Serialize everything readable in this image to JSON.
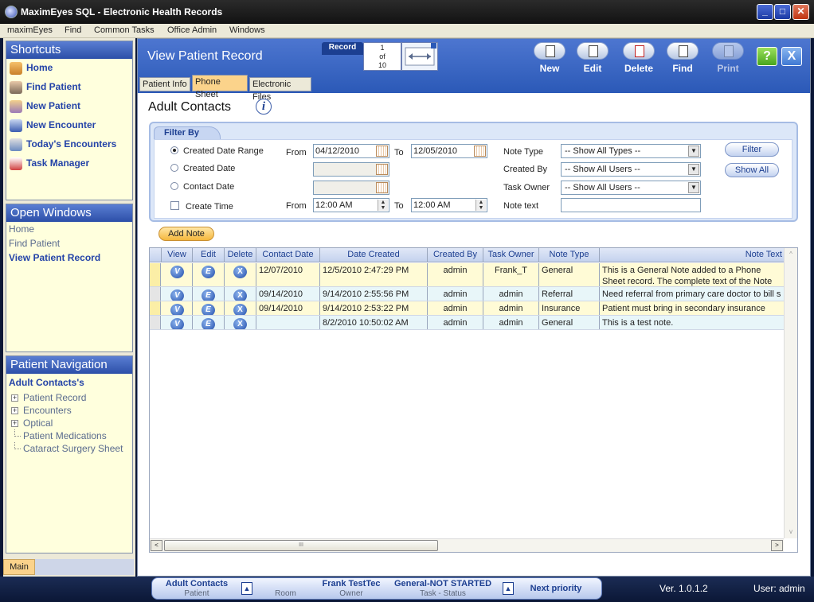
{
  "window": {
    "title": "MaximEyes SQL - Electronic Health Records",
    "controls": {
      "minimize": "_",
      "maximize": "□",
      "close": "✕"
    }
  },
  "menu": [
    "maximEyes",
    "Find",
    "Common Tasks",
    "Office Admin",
    "Windows"
  ],
  "shortcuts": {
    "title": "Shortcuts",
    "items": [
      {
        "label": "Home",
        "icon": "home-icon"
      },
      {
        "label": "Find Patient",
        "icon": "find-patient-icon"
      },
      {
        "label": "New Patient",
        "icon": "new-patient-icon"
      },
      {
        "label": "New Encounter",
        "icon": "new-encounter-icon"
      },
      {
        "label": "Today's Encounters",
        "icon": "todays-encounters-icon"
      },
      {
        "label": "Task Manager",
        "icon": "task-manager-icon"
      }
    ]
  },
  "open_windows": {
    "title": "Open Windows",
    "items": [
      "Home",
      "Find Patient",
      "View Patient Record"
    ],
    "active": "View Patient Record"
  },
  "patient_nav": {
    "title": "Patient Navigation",
    "patient": "Adult Contacts's",
    "items": [
      {
        "label": "Patient Record",
        "expandable": true
      },
      {
        "label": "Encounters",
        "expandable": true
      },
      {
        "label": "Optical",
        "expandable": true
      },
      {
        "label": "Patient Medications",
        "expandable": false
      },
      {
        "label": "Cataract Surgery Sheet",
        "expandable": false
      }
    ],
    "expand_glyph": "+"
  },
  "left_tab": "Main",
  "header": {
    "title": "View Patient Record",
    "record_label": "Record",
    "record_index": "1",
    "record_of": "of",
    "record_total": "10",
    "toolbar": [
      {
        "label": "New",
        "icon": "new-document-icon",
        "enabled": true
      },
      {
        "label": "Edit",
        "icon": "edit-document-icon",
        "enabled": true
      },
      {
        "label": "Delete",
        "icon": "delete-document-icon",
        "enabled": true
      },
      {
        "label": "Find",
        "icon": "find-document-icon",
        "enabled": true
      },
      {
        "label": "Print",
        "icon": "print-icon",
        "enabled": false
      }
    ],
    "help": "?",
    "close": "X"
  },
  "tabs": [
    "Patient Info",
    "Phone Sheet",
    "Electronic Files"
  ],
  "active_tab": "Phone Sheet",
  "section_title": "Adult Contacts",
  "info_glyph": "i",
  "filter": {
    "title": "Filter By",
    "radios": [
      {
        "label": "Created Date Range",
        "checked": true
      },
      {
        "label": "Created Date",
        "checked": false
      },
      {
        "label": "Contact Date",
        "checked": false
      }
    ],
    "create_time_label": "Create Time",
    "from_label": "From",
    "to_label": "To",
    "date_from": "04/12/2010",
    "date_to": "12/05/2010",
    "time_from": "12:00 AM",
    "time_to": "12:00 AM",
    "note_type_label": "Note Type",
    "note_type_value": "-- Show All Types --",
    "created_by_label": "Created By",
    "created_by_value": "-- Show All Users --",
    "task_owner_label": "Task Owner",
    "task_owner_value": "-- Show All Users --",
    "note_text_label": "Note text",
    "note_text_value": "",
    "filter_button": "Filter",
    "show_all_button": "Show All"
  },
  "add_note_button": "Add Note",
  "grid": {
    "columns": [
      "View",
      "Edit",
      "Delete",
      "Contact Date",
      "Date Created",
      "Created By",
      "Task Owner",
      "Note Type",
      "Note Text"
    ],
    "row_glyphs": {
      "view": "V",
      "edit": "E",
      "delete": "X"
    },
    "rows": [
      {
        "contact_date": "12/07/2010",
        "date_created": "12/5/2010 2:47:29 PM",
        "created_by": "admin",
        "task_owner": "Frank_T",
        "note_type": "General",
        "note_text": "This is a General Note added to a Phone Sheet record. The complete text of the Note displays",
        "tall": true,
        "color": "#fffbd6"
      },
      {
        "contact_date": "09/14/2010",
        "date_created": "9/14/2010 2:55:56 PM",
        "created_by": "admin",
        "task_owner": "admin",
        "note_type": "Referral",
        "note_text": "Need referral from primary care doctor to bill s",
        "tall": false,
        "color": "#e8f6f9"
      },
      {
        "contact_date": "09/14/2010",
        "date_created": "9/14/2010 2:53:22 PM",
        "created_by": "admin",
        "task_owner": "admin",
        "note_type": "Insurance",
        "note_text": "Patient must bring in secondary insurance card",
        "tall": false,
        "color": "#fffbd6"
      },
      {
        "contact_date": "",
        "date_created": "8/2/2010 10:50:02 AM",
        "created_by": "admin",
        "task_owner": "admin",
        "note_type": "General",
        "note_text": "This is a test note.",
        "tall": false,
        "color": "#e8f6f9"
      }
    ],
    "scroll_grip": "III",
    "scroll_left": "<",
    "scroll_right": ">",
    "scroll_up": "^",
    "scroll_down": "v"
  },
  "status": {
    "patient_value": "Adult Contacts",
    "patient_label": "Patient",
    "room_label": "Room",
    "owner_value": "Frank TestTec",
    "owner_label": "Owner",
    "task_value": "General-NOT STARTED",
    "task_label": "Task - Status",
    "next_priority": "Next priority",
    "arrow": "▲",
    "version": "Ver. 1.0.1.2",
    "user": "User: admin"
  },
  "colors": {
    "accent_blue": "#2b59b7",
    "panel_yellow": "#ffffdd",
    "active_tab": "#fbd38b"
  }
}
